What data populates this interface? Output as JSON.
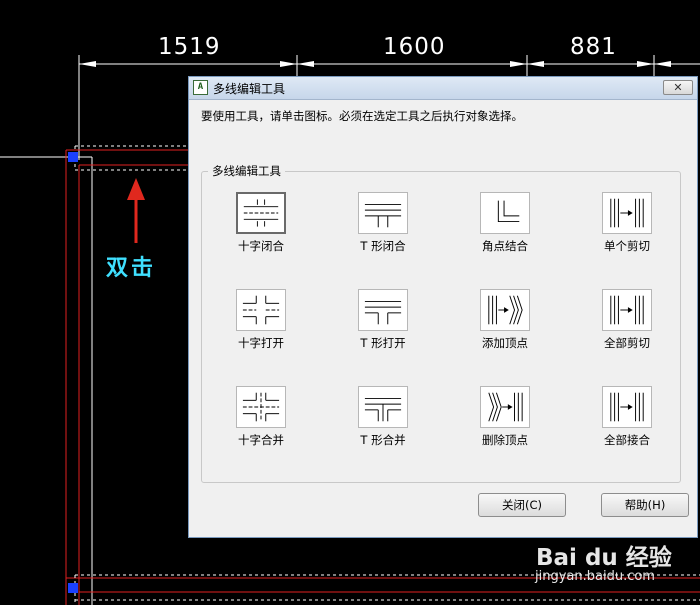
{
  "drawing": {
    "dimensions": [
      "1519",
      "1600",
      "881"
    ],
    "annotation": "双击"
  },
  "dialog": {
    "title": "多线编辑工具",
    "instruction": "要使用工具，请单击图标。必须在选定工具之后执行对象选择。",
    "group_label": "多线编辑工具",
    "tools": [
      {
        "label": "十字闭合",
        "icon": "cross-closed-icon",
        "selected": true
      },
      {
        "label": "T 形闭合",
        "icon": "tee-closed-icon"
      },
      {
        "label": "角点结合",
        "icon": "corner-joint-icon"
      },
      {
        "label": "单个剪切",
        "icon": "cut-single-icon"
      },
      {
        "label": "十字打开",
        "icon": "cross-open-icon"
      },
      {
        "label": "T 形打开",
        "icon": "tee-open-icon"
      },
      {
        "label": "添加顶点",
        "icon": "add-vertex-icon"
      },
      {
        "label": "全部剪切",
        "icon": "cut-all-icon"
      },
      {
        "label": "十字合并",
        "icon": "cross-merged-icon"
      },
      {
        "label": "T 形合并",
        "icon": "tee-merged-icon"
      },
      {
        "label": "删除顶点",
        "icon": "delete-vertex-icon"
      },
      {
        "label": "全部接合",
        "icon": "weld-all-icon"
      }
    ],
    "buttons": {
      "close_label": "关闭(C)",
      "help_label": "帮助(H)"
    }
  },
  "watermark": {
    "logo": "Bai du 经验",
    "url": "jingyan.baidu.com"
  }
}
